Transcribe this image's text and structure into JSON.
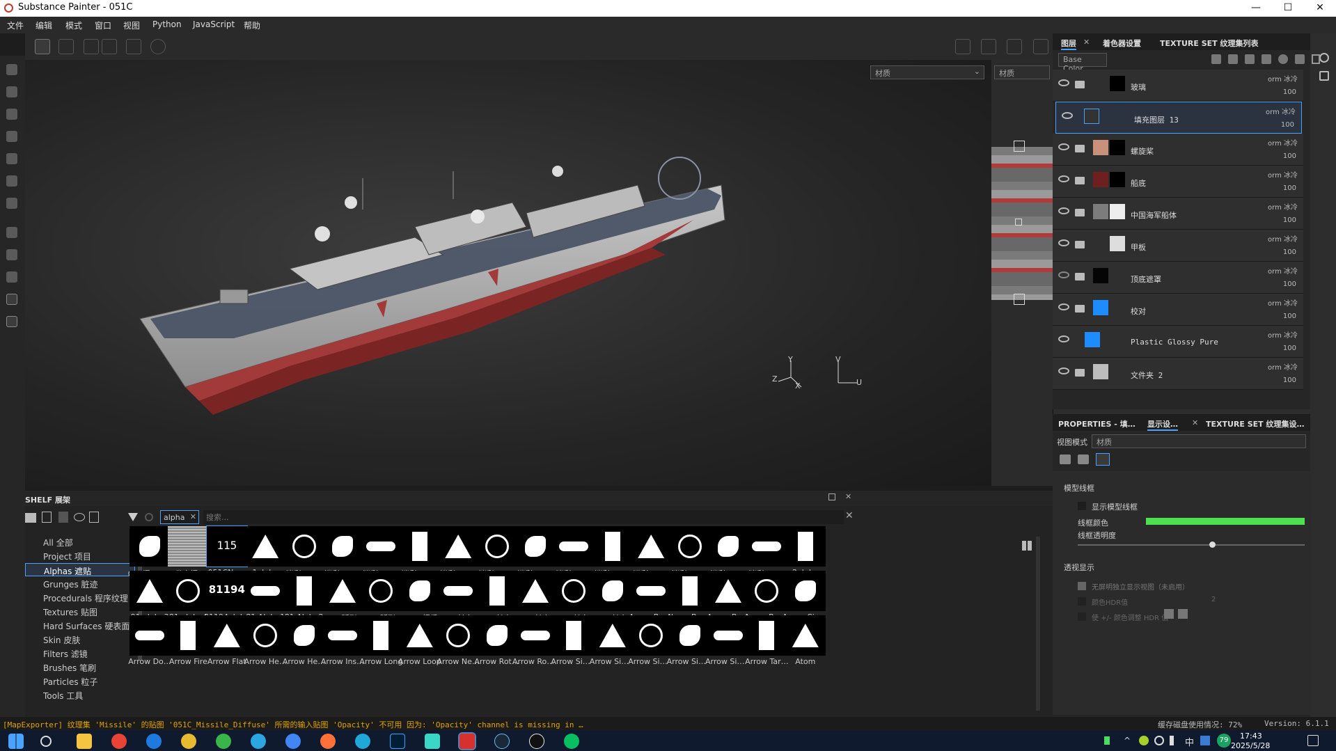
{
  "window": {
    "title": "Substance Painter - 051C",
    "minimize": "—",
    "maximize": "☐",
    "close": "✕"
  },
  "menu": [
    "文件",
    "编辑",
    "模式",
    "窗口",
    "视图",
    "Python",
    "JavaScript",
    "帮助"
  ],
  "viewport": {
    "material_dropdown": "材质",
    "uv_dropdown": "材质",
    "axis_3d": {
      "x": "X",
      "y": "Y",
      "z": "Z"
    },
    "axis_uv": {
      "u": "U",
      "v": "V"
    }
  },
  "layers": {
    "tabs": [
      "图层",
      "着色器设置",
      "TEXTURE SET 纹理集列表"
    ],
    "channel": "Base Color",
    "items": [
      {
        "name": "玻璃",
        "blend": "orm 冰冷",
        "opacity": "100"
      },
      {
        "name": "填充图层 13",
        "blend": "orm 冰冷",
        "opacity": "100"
      },
      {
        "name": "螺旋桨",
        "blend": "orm 冰冷",
        "opacity": "100"
      },
      {
        "name": "船底",
        "blend": "orm 冰冷",
        "opacity": "100"
      },
      {
        "name": "中国海军船体",
        "blend": "orm 冰冷",
        "opacity": "100"
      },
      {
        "name": "甲板",
        "blend": "orm 冰冷",
        "opacity": "100"
      },
      {
        "name": "顶底遮罩",
        "blend": "orm 冰冷",
        "opacity": "100"
      },
      {
        "name": "校对",
        "blend": "orm 冰冷",
        "opacity": "100"
      },
      {
        "name": "Plastic Glossy Pure",
        "blend": "orm 冰冷",
        "opacity": "100"
      },
      {
        "name": "文件夹 2",
        "blend": "orm 冰冷",
        "opacity": "100"
      }
    ]
  },
  "properties": {
    "tabs": [
      "PROPERTIES - 填…",
      "显示设…",
      "TEXTURE SET 纹理集设…"
    ],
    "view_mode_label": "视图模式",
    "view_mode_value": "材质",
    "section_wireframe": "模型线框",
    "show_wireframe": "显示模型线框",
    "wire_color": "线框颜色",
    "wire_opacity": "线框透明度",
    "wire_opacity_level": 0.58,
    "section_transparency": "透视显示",
    "transparency_opt": "无屏明独立显示视图（未启用）",
    "hdr": "颜色HDR值",
    "hdr_value": "2",
    "hdr_adjust": "使 +/- 颜色调整 HDR 值",
    "colors": {
      "wire": "#4fe04f"
    }
  },
  "shelf": {
    "title": "SHELF 展架",
    "filter_tag": "alpha",
    "search_placeholder": "搜索...",
    "categories": [
      "All 全部",
      "Project 项目",
      "Alphas 遮贴",
      "Grunges 脏迹",
      "Procedurals 程序纹理",
      "Textures 贴图",
      "Hard Surfaces 硬表面",
      "Skin 皮肤",
      "Filters 滤镜",
      "Brushes 笔刷",
      "Particles 粒子",
      "Tools 工具"
    ],
    "selected_category": "Alphas 遮贴",
    "row1": [
      "002门alpha",
      "01卷帘门al…",
      "051CNum",
      "1alpha",
      "1迷彩mask1",
      "1迷彩mask…",
      "1迷彩mask…",
      "1迷彩mask…",
      "1迷彩mask…",
      "1迷彩mask2",
      "1迷彩mask3",
      "1迷彩mask4",
      "1迷彩mask5",
      "1迷彩mask6",
      "1迷彩mask7",
      "1迷彩mask8",
      "1迷彩mask9",
      "2alpha"
    ],
    "row2": [
      "81 alpha3",
      "81 alpha4",
      "81194alpha",
      "81 Alpha1",
      "81 Alpha2",
      "alpha弧形…",
      "alpha弧形…",
      "alpha把手",
      "alpha长方…",
      "alpha长方…",
      "alpha长方…",
      "alpha长方…",
      "alpha长方…",
      "Arrow Band",
      "Arrow Ben…",
      "Arrow Bent",
      "Arrow Bor…",
      "Arrow Circle"
    ],
    "row3": [
      "Arrow Do…",
      "Arrow Fire",
      "Arrow Flat",
      "Arrow He…",
      "Arrow He…",
      "Arrow Ins…",
      "Arrow Long",
      "Arrow Loop",
      "Arrow Ne…",
      "Arrow Rot…",
      "Arrow Rou…",
      "Arrow Sim…",
      "Arrow Sim…",
      "Arrow Sim…",
      "Arrow Sim…",
      "Arrow Sim…",
      "Arrow Tar…",
      "Atom"
    ],
    "tile_text": {
      "num051": "115",
      "num81194": "81194"
    }
  },
  "status": {
    "message": "[MapExporter] 纹理集 'Missile' 的贴图 '051C_Missile_Diffuse' 所需的输入贴图 'Opacity' 不可用 因为: 'Opacity' channel is missing in …",
    "disk": "缓存磁盘使用情况: 72%",
    "version": "Version: 6.1.1"
  },
  "taskbar": {
    "time": "17:43",
    "date": "2025/5/28",
    "badge": "79",
    "ime": "中"
  }
}
